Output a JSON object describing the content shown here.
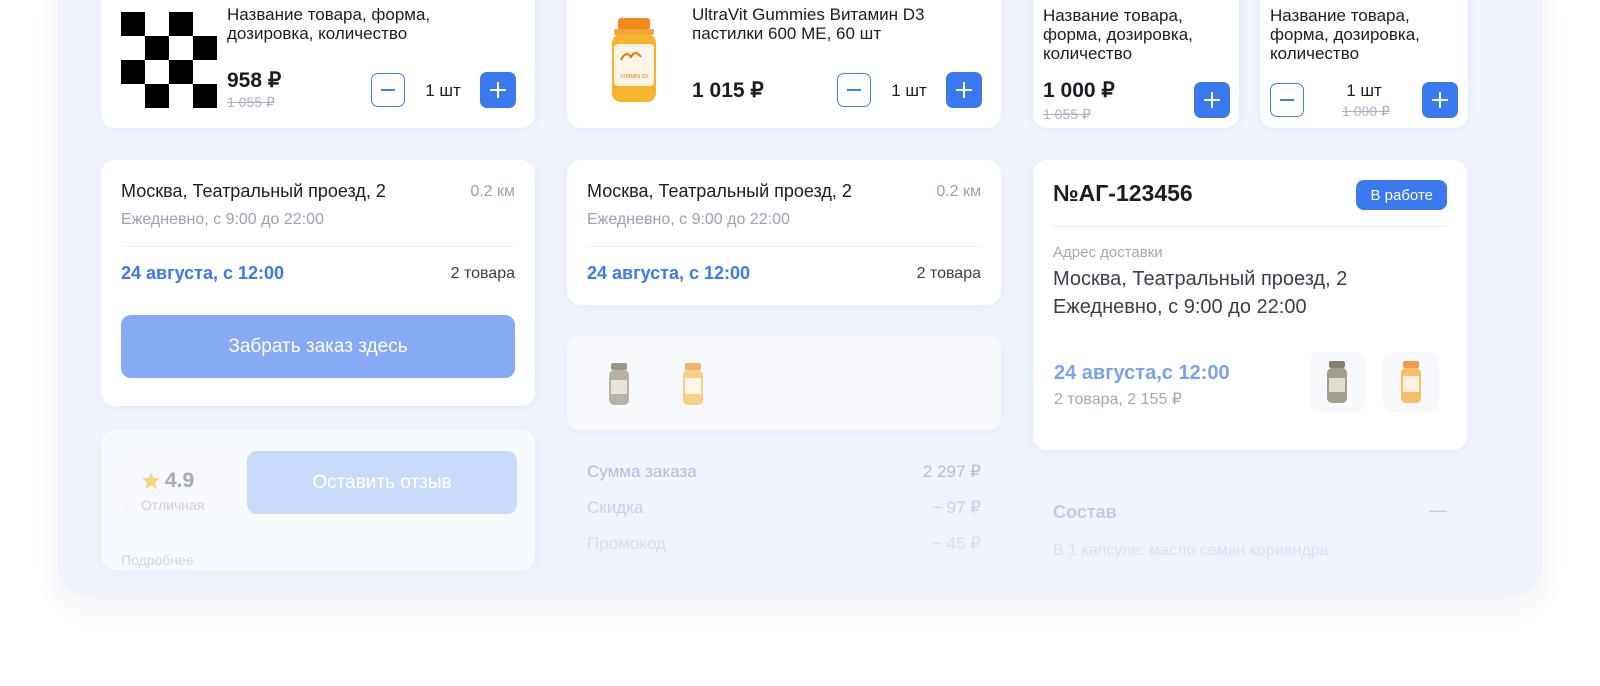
{
  "products": [
    {
      "name": "Название товара, форма, дозировка, количество",
      "price": "958 ₽",
      "old_price": "1 055 ₽",
      "qty": "1 шт"
    },
    {
      "name": "UltraVit Gummies  Витамин D3 пастилки 600 МЕ, 60 шт",
      "price": "1 015 ₽",
      "qty": "1 шт",
      "jar_label": "VITAMIN D3"
    },
    {
      "name": "Название товара, форма, дозировка, количество",
      "price": "1 000 ₽",
      "old_price": "1 055 ₽"
    },
    {
      "name": "Название товара, форма, дозировка, количество",
      "qty": "1 шт",
      "old_price": "1 000 ₽"
    }
  ],
  "pickup_cards": [
    {
      "address": "Москва, Театральный проезд, 2",
      "distance": "0.2 км",
      "hours": "Ежедневно, с 9:00 до 22:00",
      "date": "24 августа, с 12:00",
      "count": "2 товара",
      "action": "Забрать заказ здесь"
    },
    {
      "address": "Москва, Театральный проезд, 2",
      "distance": "0.2 км",
      "hours": "Ежедневно, с 9:00 до 22:00",
      "date": "24 августа, с 12:00",
      "count": "2 товара"
    }
  ],
  "review": {
    "rating": "4.9",
    "sub": "Отличная",
    "button": "Оставить отзыв",
    "footer": "Подробнее"
  },
  "summary": {
    "rows": [
      {
        "label": "Сумма заказа",
        "value": "2 297 ₽"
      },
      {
        "label": "Скидка",
        "value": "− 97 ₽"
      },
      {
        "label": "Промокод",
        "value": "− 45 ₽"
      }
    ]
  },
  "order": {
    "number": "№АГ-123456",
    "status": "В работе",
    "address_label": "Адрес доставки",
    "address": "Москва, Театральный проезд, 2",
    "hours": "Ежедневно, с 9:00 до 22:00",
    "date": "24 августа,с 12:00",
    "items": "2 товара, 2 155 ₽"
  },
  "composition": {
    "title": "Состав",
    "text": "В 1 капсуле: масло семян кориандра",
    "toggle": "—"
  },
  "colors": {
    "accent": "#3b79ee",
    "board": "#eef3fd",
    "muted": "#9aa1b0"
  }
}
